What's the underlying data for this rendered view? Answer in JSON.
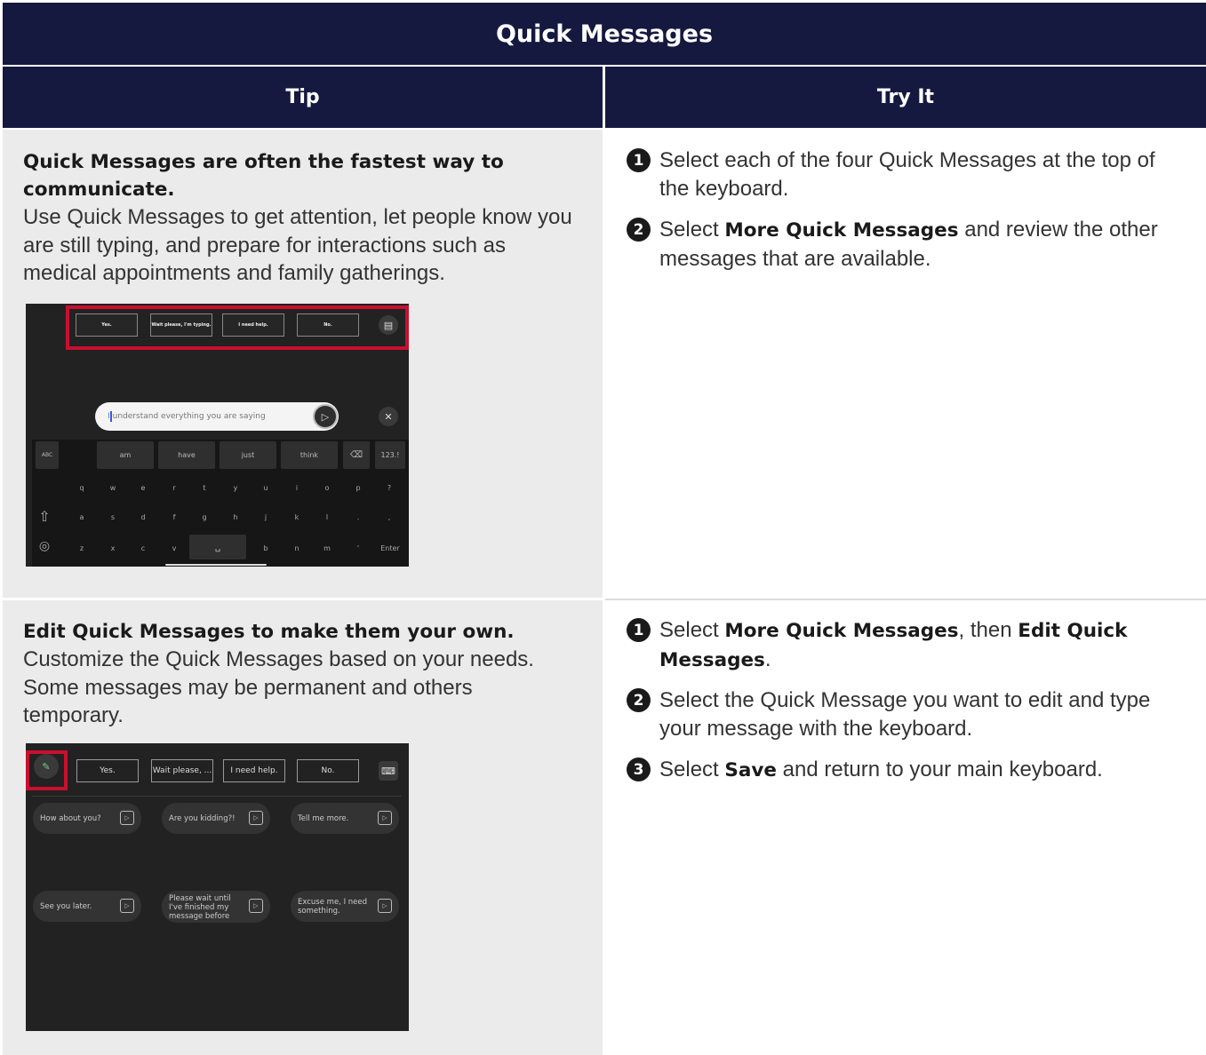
{
  "title": "Quick Messages",
  "headers": {
    "tip": "Tip",
    "try": "Try It"
  },
  "row1": {
    "tip_heading": "Quick Messages are often the fastest way to communicate.",
    "tip_body": "Use Quick Messages to get attention, let people know you are still typing, and prepare for interactions such as medical appointments and family gatherings.",
    "steps": [
      {
        "num": "1",
        "pre": "Select each of the four Quick Messages at the top of the keyboard.",
        "bold": "",
        "mid": "",
        "bold2": "",
        "post": ""
      },
      {
        "num": "2",
        "pre": "Select ",
        "bold": "More Quick Messages",
        "mid": " and review the other messages that are available.",
        "bold2": "",
        "post": ""
      }
    ],
    "screenshot": {
      "quick_messages": [
        "Yes.",
        "Wait please, I'm typing.",
        "I need help.",
        "No."
      ],
      "text_value": "understand everything you are saying",
      "text_first_letter": "I",
      "word_predictions": [
        "am",
        "have",
        "just",
        "think"
      ],
      "key_123": "123.!",
      "key_abc": "ABC",
      "row_q": [
        "q",
        "w",
        "e",
        "r",
        "t",
        "y",
        "u",
        "i",
        "o",
        "p",
        "?"
      ],
      "row_a": [
        "a",
        "s",
        "d",
        "f",
        "g",
        "h",
        "j",
        "k",
        "l",
        ".",
        ","
      ],
      "row_z": [
        "z",
        "x",
        "c",
        "v",
        "b",
        "n",
        "m",
        "'"
      ],
      "key_enter": "Enter"
    }
  },
  "row2": {
    "tip_heading": "Edit Quick Messages to make them your own.",
    "tip_body": "Customize the Quick Messages based on your needs. Some messages may be permanent and others temporary.",
    "steps": [
      {
        "num": "1",
        "pre": "Select ",
        "bold": "More Quick Messages",
        "mid": ", then ",
        "bold2": "Edit Quick Messages",
        "post": "."
      },
      {
        "num": "2",
        "pre": "Select the Quick Message you want to edit and type your message with the keyboard.",
        "bold": "",
        "mid": "",
        "bold2": "",
        "post": ""
      },
      {
        "num": "3",
        "pre": "Select ",
        "bold": "Save",
        "mid": " and return to your main keyboard.",
        "bold2": "",
        "post": ""
      }
    ],
    "screenshot": {
      "quick_messages": [
        "Yes.",
        "Wait please, ...",
        "I need help.",
        "No."
      ],
      "cards": [
        "How about you?",
        "Are you kidding?!",
        "Tell me more.",
        "See you later.",
        "Please wait until I've finished my message before",
        "Excuse me, I need something."
      ]
    }
  }
}
